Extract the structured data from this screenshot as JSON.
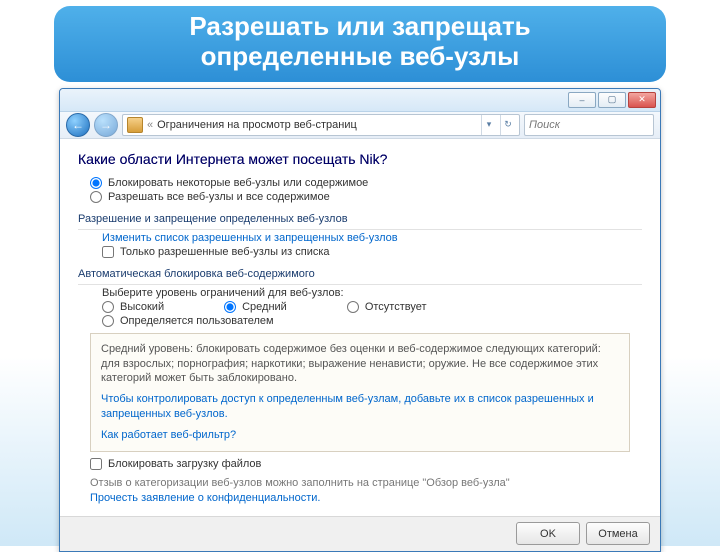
{
  "banner": {
    "line1": "Разрешать или запрещать",
    "line2": "определенные веб-узлы"
  },
  "window": {
    "buttons": {
      "min": "–",
      "max": "▢",
      "close": "✕"
    },
    "addr": {
      "back": "←",
      "fwd": "→",
      "path_prefix": "«",
      "path": "Ограничения на просмотр веб-страниц",
      "search_placeholder": "Поиск"
    }
  },
  "content": {
    "heading": "Какие области Интернета может посещать Nik?",
    "opt_block": "Блокировать некоторые веб-узлы или содержимое",
    "opt_allow_all": "Разрешать все веб-узлы и все содержимое",
    "sect_allow": "Разрешение и запрещение определенных веб-узлов",
    "link_edit_list": "Изменить список разрешенных  и запрещенных веб-узлов",
    "chk_only_list": "Только разрешенные веб-узлы из списка",
    "sect_auto": "Автоматическая блокировка веб-содержимого",
    "level_prompt": "Выберите уровень ограничений для веб-узлов:",
    "levels": {
      "high": "Высокий",
      "medium": "Средний",
      "none": "Отсутствует",
      "custom": "Определяется пользователем"
    },
    "desc": "Средний уровень: блокировать содержимое без оценки и веб-содержимое следующих категорий: для взрослых; порнография; наркотики; выражение ненависти; оружие. Не все содержимое этих категорий может быть заблокировано.",
    "desc_link1": "Чтобы контролировать доступ к определенным веб-узлам, добавьте их в список разрешенных и запрещенных веб-узлов.",
    "desc_link2": "Как работает веб-фильтр?",
    "chk_block_dl": "Блокировать загрузку файлов",
    "foot1": "Отзыв о категоризации веб-узлов можно заполнить на странице \"Обзор веб-узла\"",
    "foot2": "Прочесть заявление о конфиденциальности.",
    "btn_ok": "OK",
    "btn_cancel": "Отмена"
  }
}
